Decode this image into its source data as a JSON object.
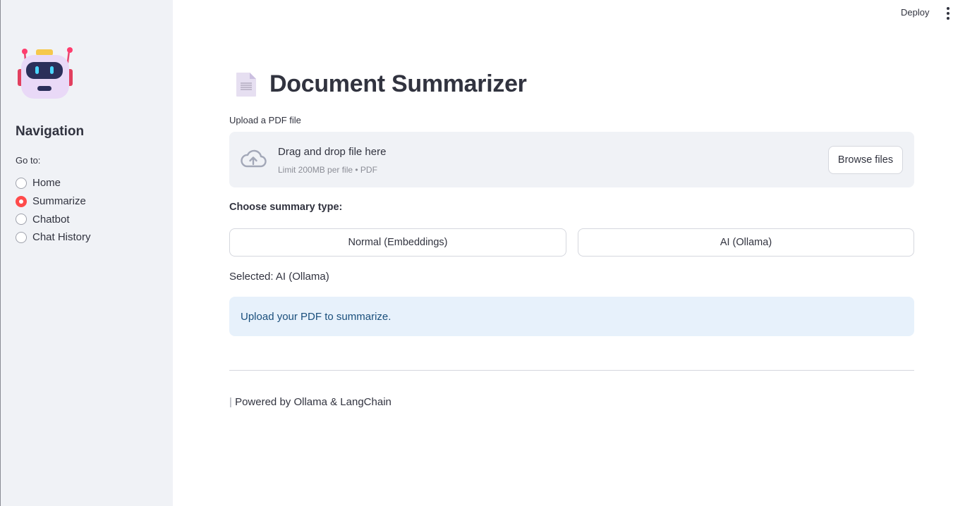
{
  "topbar": {
    "deploy_label": "Deploy"
  },
  "sidebar": {
    "title": "Navigation",
    "goto_label": "Go to:",
    "items": [
      {
        "label": "Home",
        "selected": false
      },
      {
        "label": "Summarize",
        "selected": true
      },
      {
        "label": "Chatbot",
        "selected": false
      },
      {
        "label": "Chat History",
        "selected": false
      }
    ]
  },
  "main": {
    "title": "Document Summarizer",
    "upload": {
      "label": "Upload a PDF file",
      "drop_title": "Drag and drop file here",
      "drop_limit": "Limit 200MB per file • PDF",
      "browse_label": "Browse files"
    },
    "summary": {
      "choose_label": "Choose summary type:",
      "options": [
        "Normal (Embeddings)",
        "AI (Ollama)"
      ],
      "selected_text": "Selected: AI (Ollama)"
    },
    "info_message": "Upload your PDF to summarize.",
    "footer": {
      "bar": "|",
      "text": " Powered by Ollama & LangChain"
    }
  },
  "icons": {
    "logo": "robot-icon",
    "title": "document-icon",
    "upload": "cloud-upload-icon",
    "menu": "more-vertical-icon"
  },
  "colors": {
    "accent": "#ff4b4b",
    "sidebar_bg": "#f0f2f6",
    "info_bg": "#e7f1fb",
    "info_text": "#1a4f7c"
  }
}
